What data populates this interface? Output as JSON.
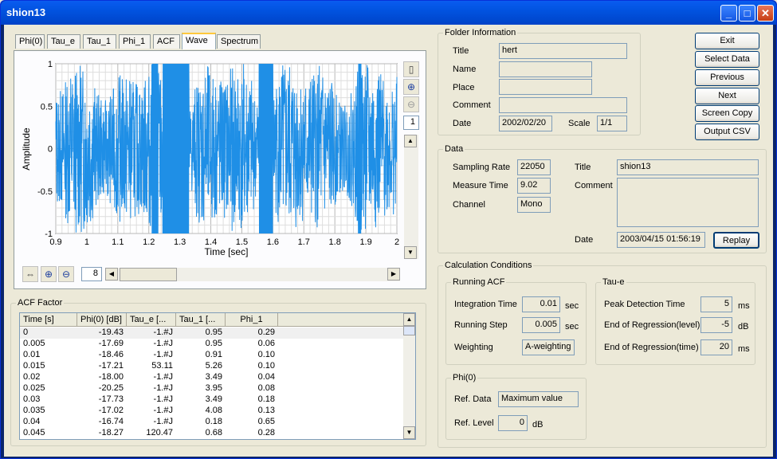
{
  "window": {
    "title": "shion13"
  },
  "tabs": [
    "Phi(0)",
    "Tau_e",
    "Tau_1",
    "Phi_1",
    "ACF",
    "Wave",
    "Spectrum"
  ],
  "active_tab": "Wave",
  "chart_data": {
    "type": "line",
    "title": "",
    "xlabel": "Time [sec]",
    "ylabel": "Amplitude",
    "xlim": [
      0.9,
      2
    ],
    "ylim": [
      -1,
      1
    ],
    "x_ticks": [
      "0.9",
      "1",
      "1.1",
      "1.2",
      "1.3",
      "1.4",
      "1.5",
      "1.6",
      "1.7",
      "1.8",
      "1.9",
      "2"
    ],
    "y_ticks": [
      "1",
      "0.5",
      "0",
      "-0.5",
      "-1"
    ],
    "grid": true,
    "series": [
      {
        "color": "#1f8fe6",
        "description_only": false
      }
    ],
    "clipped_regions": [
      [
        1.245,
        1.33
      ],
      [
        1.555,
        1.6
      ],
      [
        1.21,
        1.23
      ],
      [
        1.875,
        1.885
      ]
    ]
  },
  "chart_toolbar": {
    "page_value": "1",
    "zoom_value": "8"
  },
  "acf": {
    "label": "ACF Factor",
    "columns": [
      "Time [s]",
      "Phi(0) [dB]",
      "Tau_e [...",
      "Tau_1 [...",
      "Phi_1"
    ],
    "rows": [
      [
        "0",
        "-19.43",
        "-1.#J",
        "0.95",
        "0.29"
      ],
      [
        "0.005",
        "-17.69",
        "-1.#J",
        "0.95",
        "0.06"
      ],
      [
        "0.01",
        "-18.46",
        "-1.#J",
        "0.91",
        "0.10"
      ],
      [
        "0.015",
        "-17.21",
        "53.11",
        "5.26",
        "0.10"
      ],
      [
        "0.02",
        "-18.00",
        "-1.#J",
        "3.49",
        "0.04"
      ],
      [
        "0.025",
        "-20.25",
        "-1.#J",
        "3.95",
        "0.08"
      ],
      [
        "0.03",
        "-17.73",
        "-1.#J",
        "3.49",
        "0.18"
      ],
      [
        "0.035",
        "-17.02",
        "-1.#J",
        "4.08",
        "0.13"
      ],
      [
        "0.04",
        "-16.74",
        "-1.#J",
        "0.18",
        "0.65"
      ],
      [
        "0.045",
        "-18.27",
        "120.47",
        "0.68",
        "0.28"
      ]
    ]
  },
  "folder": {
    "label": "Folder Information",
    "title_label": "Title",
    "title": "hert",
    "name_label": "Name",
    "name": "",
    "place_label": "Place",
    "place": "",
    "comment_label": "Comment",
    "comment": "",
    "date_label": "Date",
    "date": "2002/02/20",
    "scale_label": "Scale",
    "scale": "1/1"
  },
  "buttons": {
    "exit": "Exit",
    "select_data": "Select Data",
    "previous": "Previous",
    "next": "Next",
    "screen_copy": "Screen Copy",
    "output_csv": "Output CSV",
    "replay": "Replay"
  },
  "data": {
    "label": "Data",
    "sampling_rate_label": "Sampling Rate",
    "sampling_rate": "22050",
    "measure_time_label": "Measure Time",
    "measure_time": "9.02",
    "channel_label": "Channel",
    "channel": "Mono",
    "title_label": "Title",
    "title": "shion13",
    "comment_label": "Comment",
    "comment": "",
    "date_label": "Date",
    "date": "2003/04/15 01:56:19"
  },
  "calc": {
    "label": "Calculation Conditions",
    "running_acf_label": "Running ACF",
    "integration_time_label": "Integration Time",
    "integration_time": "0.01",
    "integration_unit": "sec",
    "running_step_label": "Running Step",
    "running_step": "0.005",
    "running_step_unit": "sec",
    "weighting_label": "Weighting",
    "weighting": "A-weighting",
    "tau_e_label": "Tau-e",
    "peak_detection_label": "Peak Detection Time",
    "peak_detection": "5",
    "peak_detection_unit": "ms",
    "end_reg_level_label": "End of Regression(level)",
    "end_reg_level": "-5",
    "end_reg_level_unit": "dB",
    "end_reg_time_label": "End of Regression(time)",
    "end_reg_time": "20",
    "end_reg_time_unit": "ms",
    "phi0_label": "Phi(0)",
    "ref_data_label": "Ref. Data",
    "ref_data": "Maximum value",
    "ref_level_label": "Ref. Level",
    "ref_level": "0",
    "ref_level_unit": "dB"
  }
}
